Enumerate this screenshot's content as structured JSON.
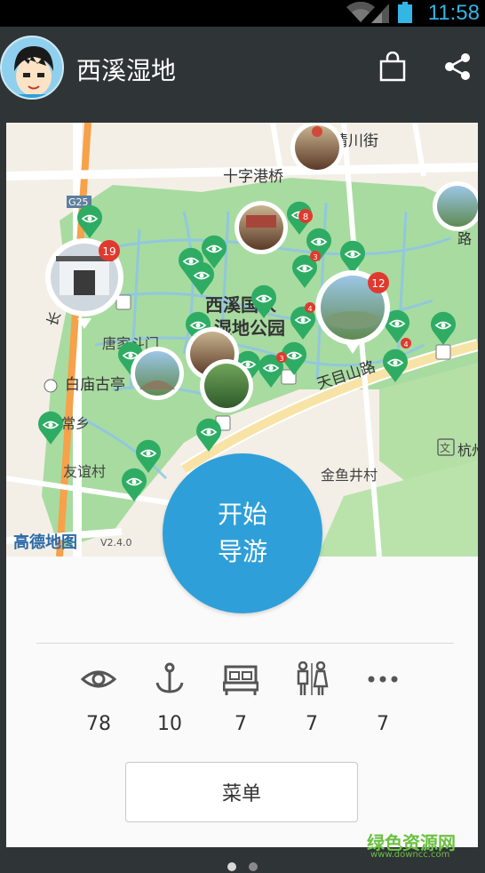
{
  "status_bar": {
    "time": "11:58",
    "accent_color": "#33b5e5"
  },
  "app_bar": {
    "title": "西溪湿地",
    "actions": [
      "bag-icon",
      "share-icon"
    ]
  },
  "map": {
    "roads": {
      "shichuan": "清川街",
      "shizi": "十字港桥",
      "tianmushan": "天目山路",
      "g25": "G25"
    },
    "places": {
      "park": "西溪国家",
      "park2": "湿地公园",
      "tangjiadou": "唐家斗门",
      "baimiao": "白庙古亭",
      "changxiang": "常乡",
      "youyi": "友谊村",
      "jinyu": "金鱼井村",
      "hangzhou": "杭州",
      "wen": "文",
      "lu": "路",
      "chang": "长"
    },
    "provider": "高德地图",
    "version": "V2.4.0",
    "badges": [
      "19",
      "8",
      "3",
      "12",
      "4",
      "3",
      "4"
    ]
  },
  "start_button": {
    "line1": "开始",
    "line2": "导游"
  },
  "stats": [
    {
      "icon": "eye-icon",
      "value": "78"
    },
    {
      "icon": "anchor-icon",
      "value": "10"
    },
    {
      "icon": "bed-icon",
      "value": "7"
    },
    {
      "icon": "restroom-icon",
      "value": "7"
    },
    {
      "icon": "more-icon",
      "value": "7"
    }
  ],
  "menu_button": {
    "label": "菜单"
  },
  "watermark": {
    "line1": "绿色资源网",
    "line2": "www.downcc.com"
  },
  "page_indicator": {
    "active_color": "#d8d8d8",
    "inactive_color": "#8a8a8a"
  }
}
